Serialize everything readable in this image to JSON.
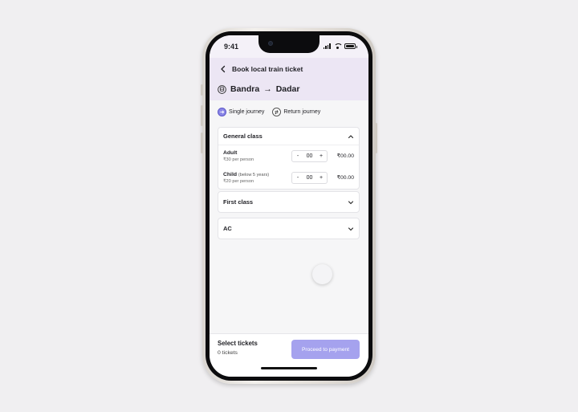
{
  "status_bar": {
    "time": "9:41"
  },
  "header": {
    "title": "Book local train ticket",
    "from": "Bandra",
    "arrow": "→",
    "to": "Dadar"
  },
  "journey": {
    "options": [
      {
        "label": "Single journey",
        "selected": true
      },
      {
        "label": "Return journey",
        "selected": false
      }
    ]
  },
  "classes": [
    {
      "title": "General class",
      "expanded": true,
      "rows": [
        {
          "label": "Adult",
          "sub": "",
          "price": "₹30 per person",
          "minus": "-",
          "qty": "00",
          "plus": "+",
          "amount": "₹00.00"
        },
        {
          "label": "Child",
          "sub": "(below 5 years)",
          "price": "₹20 per person",
          "minus": "-",
          "qty": "00",
          "plus": "+",
          "amount": "₹00.00"
        }
      ]
    },
    {
      "title": "First class",
      "expanded": false
    },
    {
      "title": "AC",
      "expanded": false
    }
  ],
  "footer": {
    "title": "Select tickets",
    "count": "0 tickets",
    "button": "Proceed to payment"
  },
  "colors": {
    "accent": "#a5a2ee",
    "header_bg": "#ece6f4",
    "active_toggle": "#8b87e6"
  },
  "icons": [
    "back-arrow-icon",
    "train-icon",
    "single-journey-icon",
    "return-journey-icon",
    "chevron-up-icon",
    "chevron-down-icon"
  ]
}
